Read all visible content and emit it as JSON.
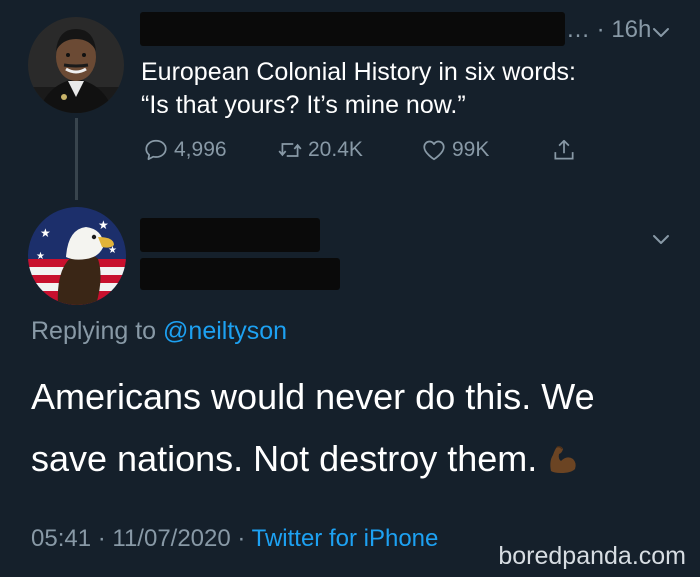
{
  "tweet1": {
    "time": "… · 16h",
    "text_line1": "European Colonial History in six words:",
    "text_line2": "“Is that yours? It’s mine now.”",
    "reply_count": "4,996",
    "retweet_count": "20.4K",
    "like_count": "99K",
    "icons": [
      "reply-icon",
      "retweet-icon",
      "like-icon",
      "share-icon",
      "chevron-down-icon"
    ]
  },
  "tweet2": {
    "replying_prefix": "Replying to",
    "replying_mention": "@neiltyson",
    "text_line1": "Americans would never do this. We",
    "text_line2": "save nations. Not destroy them.",
    "emoji": "flexed-biceps-emoji",
    "footer_datetime": "05:41 · 11/07/2020 · ",
    "footer_source": "Twitter for iPhone"
  },
  "watermark": "boredpanda.com",
  "colors": {
    "background": "#15202b",
    "text": "#ffffff",
    "secondary": "#8899a6",
    "link": "#1da1f2",
    "thread_line": "#38444d"
  }
}
